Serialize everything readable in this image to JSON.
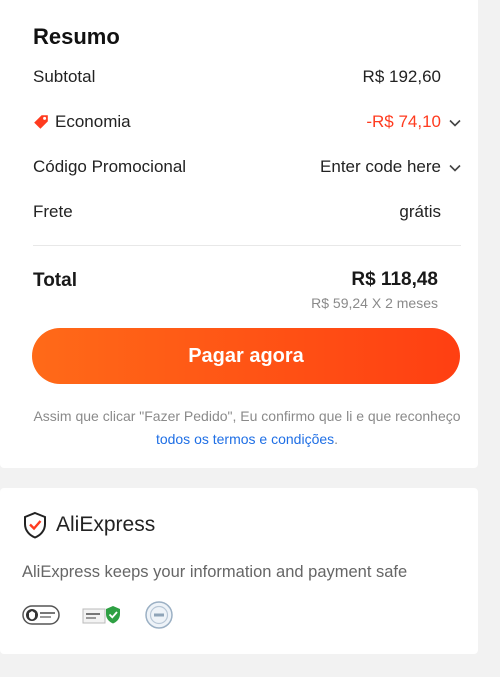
{
  "summary": {
    "title": "Resumo",
    "subtotal": {
      "label": "Subtotal",
      "value": "R$ 192,60"
    },
    "economia": {
      "label": "Economia",
      "value": "-R$ 74,10"
    },
    "promo": {
      "label": "Código Promocional",
      "value": "Enter code here"
    },
    "frete": {
      "label": "Frete",
      "value": "grátis"
    },
    "total": {
      "label": "Total",
      "value": "R$ 118,48",
      "installments": "R$ 59,24 X 2 meses"
    },
    "pay_button": "Pagar agora",
    "terms": {
      "text": "Assim que clicar \"Fazer Pedido\", Eu confirmo que li e que reconheço ",
      "link": "todos os termos e condições",
      "end": "."
    }
  },
  "trust": {
    "brand": "AliExpress",
    "message": "AliExpress keeps your information and payment safe"
  },
  "colors": {
    "accent": "#ff3f12",
    "discount": "#ff3b1f",
    "link": "#1f6fe5"
  },
  "icons": [
    "tag-icon",
    "chevron-down-icon",
    "shield-check-icon",
    "security-badge-icon",
    "ssl-badge-icon",
    "pci-badge-icon"
  ]
}
